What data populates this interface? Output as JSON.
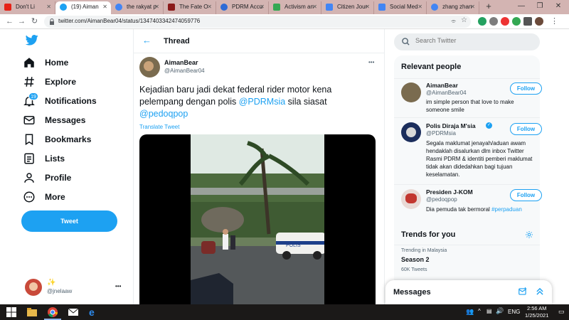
{
  "tabs": [
    "Don't Li",
    "(19) Aiman",
    "the rakyat p",
    "The Fate O",
    "PDRM Accu",
    "Activism an",
    "Citizen Jour",
    "Social Med",
    "zhang zhan"
  ],
  "browser": {
    "url": "twitter.com/AimanBear04/status/1347403342474059776"
  },
  "nav": {
    "home": "Home",
    "explore": "Explore",
    "notifications": "Notifications",
    "notif_count": "19",
    "messages": "Messages",
    "bookmarks": "Bookmarks",
    "lists": "Lists",
    "profile": "Profile",
    "more": "More",
    "tweet_button": "Tweet",
    "account_name": "✨",
    "account_handle": "@jnelaaw",
    "more_dots": "•••"
  },
  "thread": {
    "title": "Thread",
    "author_name": "AimanBear",
    "author_handle": "@AimanBear04",
    "text_before": "Kejadian baru jadi dekat federal rider motor kena pelempang dengan polis",
    "mention1": "@PDRMsia",
    "text_mid": "sila siasat",
    "mention2": "@pedoqpop",
    "translate": "Translate Tweet",
    "video_car_text": "POLIS"
  },
  "search": {
    "placeholder": "Search Twitter"
  },
  "relevant": {
    "title": "Relevant people",
    "people": [
      {
        "name": "AimanBear",
        "handle": "@AimanBear04",
        "bio": "im simple person that love to make someone smile",
        "button": "Follow"
      },
      {
        "name": "Polis Diraja M'sia",
        "handle": "@PDRMsia",
        "bio": "Segala maklumat jenayah/aduan awam hendaklah disalurkan dlm inbox Twitter Rasmi PDRM & identiti pemberi maklumat tidak akan didedahkan bagi tujuan keselamatan.",
        "button": "Follow"
      },
      {
        "name": "Presiden J-KOM",
        "handle": "@pedoqpop",
        "bio_text": "Dia pemuda tak bermoral",
        "bio_tag": "#perpaduan",
        "button": "Follow"
      }
    ]
  },
  "trends": {
    "title": "Trends for you",
    "items": [
      {
        "context": "Trending in Malaysia",
        "name": "Season 2",
        "count": "60K Tweets"
      }
    ]
  },
  "messages": {
    "title": "Messages"
  },
  "taskbar": {
    "lang": "ENG",
    "time": "2:56 AM",
    "date": "1/25/2021"
  },
  "colors": {
    "accent": "#1da1f2",
    "tabstrip": "#d3b4b2",
    "taskbar": "#1b1918"
  }
}
